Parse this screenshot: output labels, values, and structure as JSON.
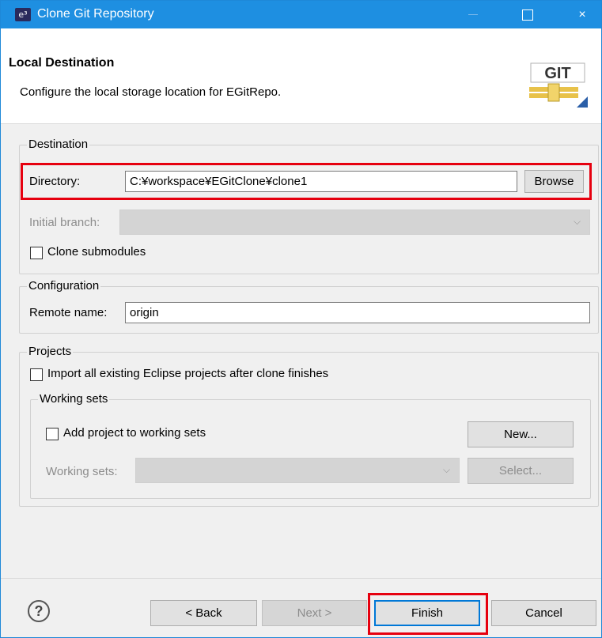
{
  "window": {
    "title": "Clone Git Repository",
    "app_icon": "eclipse-icon",
    "controls": {
      "minimize": "minimize-icon",
      "maximize": "maximize-icon",
      "close": "×"
    }
  },
  "header": {
    "title": "Local Destination",
    "description": "Configure the local storage location for EGitRepo.",
    "logo_text": "GIT"
  },
  "destination": {
    "group_label": "Destination",
    "directory_label": "Directory:",
    "directory_value": "C:¥workspace¥EGitClone¥clone1",
    "browse_label": "Browse",
    "initial_branch_label": "Initial branch:",
    "initial_branch_value": "",
    "clone_submodules_label": "Clone submodules",
    "clone_submodules_checked": false
  },
  "configuration": {
    "group_label": "Configuration",
    "remote_name_label": "Remote name:",
    "remote_name_value": "origin"
  },
  "projects": {
    "group_label": "Projects",
    "import_label": "Import all existing Eclipse projects after clone finishes",
    "import_checked": false,
    "working_sets": {
      "group_label": "Working sets",
      "add_label": "Add project to working sets",
      "add_checked": false,
      "new_label": "New...",
      "combo_label": "Working sets:",
      "combo_value": "",
      "select_label": "Select..."
    }
  },
  "footer": {
    "help_icon": "?",
    "back_label": "< Back",
    "next_label": "Next >",
    "finish_label": "Finish",
    "cancel_label": "Cancel"
  },
  "colors": {
    "titlebar": "#1e8fe1",
    "highlight": "#e6000f",
    "default_button_border": "#0078d7"
  }
}
